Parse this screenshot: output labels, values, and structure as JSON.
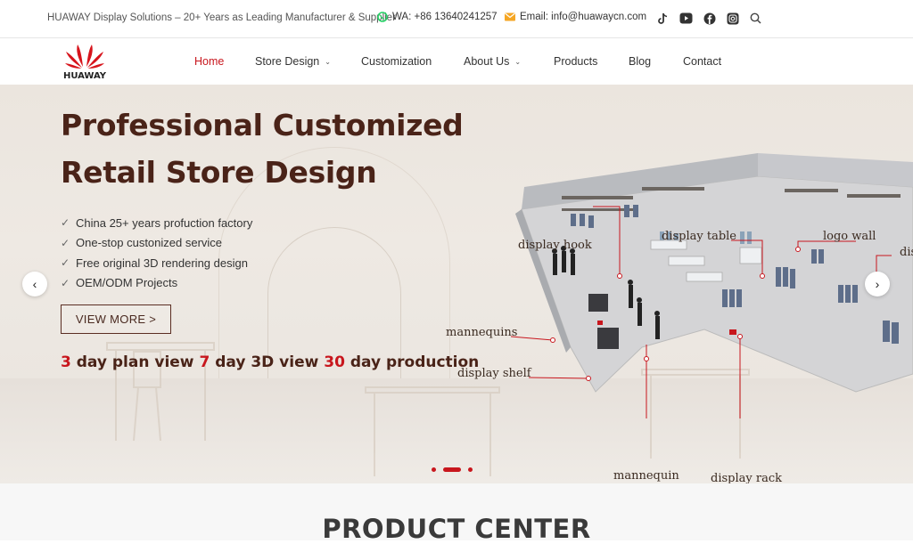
{
  "topbar": {
    "tagline": "HUAWAY Display Solutions – 20+ Years as Leading Manufacturer & Supplier",
    "whatsapp": "WA: +86 13640241257",
    "email": "Email: info@huawaycn.com",
    "social_icons": [
      "tiktok-icon",
      "youtube-icon",
      "facebook-icon",
      "instagram-icon",
      "search-icon"
    ]
  },
  "logo": {
    "text": "HUAWAY"
  },
  "nav": {
    "items": [
      {
        "label": "Home",
        "active": true
      },
      {
        "label": "Store Design",
        "dropdown": true
      },
      {
        "label": "Customization"
      },
      {
        "label": "About Us",
        "dropdown": true
      },
      {
        "label": "Products"
      },
      {
        "label": "Blog"
      },
      {
        "label": "Contact"
      }
    ]
  },
  "hero": {
    "title_line1": "Professional Customized",
    "title_line2": "Retail Store Design",
    "features": [
      "China 25+ years profuction factory",
      "One-stop custonized service",
      "Free original 3D rendering design",
      "OEM/ODM Projects"
    ],
    "cta": "VIEW MORE >",
    "plan": {
      "n1": "3",
      "t1": " day plan view ",
      "n2": "7",
      "t2": " day 3D view ",
      "n3": "30",
      "t3": " day production"
    },
    "slides": {
      "count": 3,
      "active": 2
    }
  },
  "diagram": {
    "labels": {
      "hook": "display hook",
      "table": "display table",
      "logo_wall": "logo wall",
      "cut": "dis",
      "mannequins": "mannequins",
      "shelf": "display shelf",
      "mannequin": "mannequin",
      "rack": "display rack"
    }
  },
  "section2": {
    "title": "PRODUCT CENTER"
  },
  "colors": {
    "brand_red": "#c8161d",
    "title_brown": "#4a2318"
  }
}
